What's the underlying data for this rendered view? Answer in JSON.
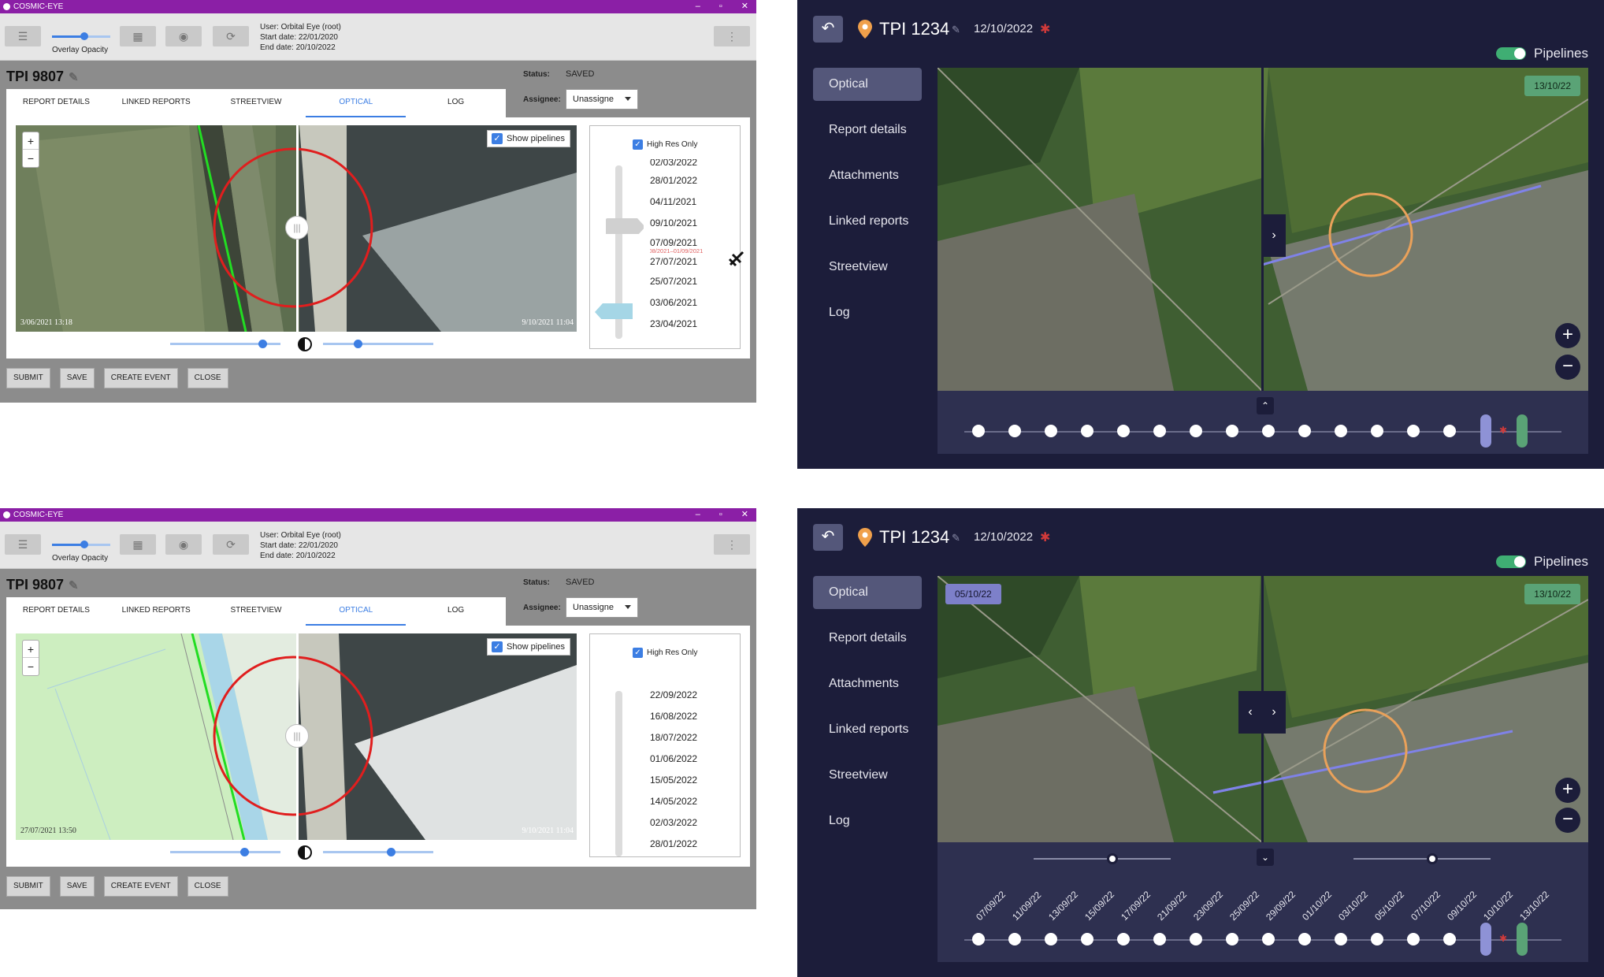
{
  "legacy_top": {
    "window_title": "COSMIC-EYE",
    "toolbar": {
      "opacity_label": "Overlay Opacity",
      "opacity_value": 0.55
    },
    "user": {
      "user": "User: Orbital Eye (root)",
      "start": "Start date: 22/01/2020",
      "end": "End date: 20/10/2022"
    },
    "title": "TPI 9807",
    "status_label": "Status:",
    "status_value": "SAVED",
    "assignee_label": "Assignee:",
    "assignee_value": "Unassigne",
    "tabs": [
      "REPORT DETAILS",
      "LINKED REPORTS",
      "STREETVIEW",
      "OPTICAL",
      "LOG"
    ],
    "show_pipelines": "Show pipelines",
    "left_stamp": "3/06/2021 13:18",
    "right_stamp": "9/10/2021 11:04",
    "high_res_only": "High Res Only",
    "dates": [
      "02/03/2022",
      "28/01/2022",
      "04/11/2021",
      "09/10/2021",
      "07/09/2021",
      "27/07/2021",
      "25/07/2021",
      "03/06/2021",
      "23/04/2021"
    ],
    "range_note": "26/08/2021–01/09/2021",
    "buttons": [
      "SUBMIT",
      "SAVE",
      "CREATE EVENT",
      "CLOSE"
    ]
  },
  "legacy_bottom": {
    "window_title": "COSMIC-EYE",
    "toolbar": {
      "opacity_label": "Overlay Opacity",
      "opacity_value": 0.55
    },
    "user": {
      "user": "User: Orbital Eye (root)",
      "start": "Start date: 22/01/2020",
      "end": "End date: 20/10/2022"
    },
    "title": "TPI 9807",
    "status_label": "Status:",
    "status_value": "SAVED",
    "assignee_label": "Assignee:",
    "assignee_value": "Unassigne",
    "tabs": [
      "REPORT DETAILS",
      "LINKED REPORTS",
      "STREETVIEW",
      "OPTICAL",
      "LOG"
    ],
    "show_pipelines": "Show pipelines",
    "left_stamp": "27/07/2021 13:50",
    "right_stamp": "9/10/2021 11:04",
    "high_res_only": "High Res Only",
    "dates": [
      "22/09/2022",
      "16/08/2022",
      "18/07/2022",
      "01/06/2022",
      "15/05/2022",
      "14/05/2022",
      "02/03/2022",
      "28/01/2022"
    ],
    "buttons": [
      "SUBMIT",
      "SAVE",
      "CREATE EVENT",
      "CLOSE"
    ]
  },
  "dark_top": {
    "title": "TPI 1234",
    "date": "12/10/2022",
    "pipelines_label": "Pipelines",
    "nav": [
      "Optical",
      "Report details",
      "Attachments",
      "Linked reports",
      "Streetview",
      "Log"
    ],
    "right_badge": "13/10/22"
  },
  "dark_bottom": {
    "title": "TPI 1234",
    "date": "12/10/2022",
    "pipelines_label": "Pipelines",
    "nav": [
      "Optical",
      "Report details",
      "Attachments",
      "Linked reports",
      "Streetview",
      "Log"
    ],
    "left_badge": "05/10/22",
    "right_badge": "13/10/22",
    "timeline_labels": [
      "07/09/22",
      "11/09/22",
      "13/09/22",
      "15/09/22",
      "17/09/22",
      "21/09/22",
      "23/09/22",
      "25/09/22",
      "29/09/22",
      "01/10/22",
      "03/10/22",
      "05/10/22",
      "07/10/22",
      "09/10/22",
      "10/10/22",
      "13/10/22"
    ]
  },
  "colors": {
    "accent": "#3c7ee3",
    "titlebar": "#8b1fa6",
    "dark_bg": "#1c1d3a",
    "nav_active": "#54577a",
    "green": "#3fae73",
    "lavender": "#8e92d6",
    "circle_red": "#e01e1e",
    "circle_orange": "#e9a15a"
  }
}
